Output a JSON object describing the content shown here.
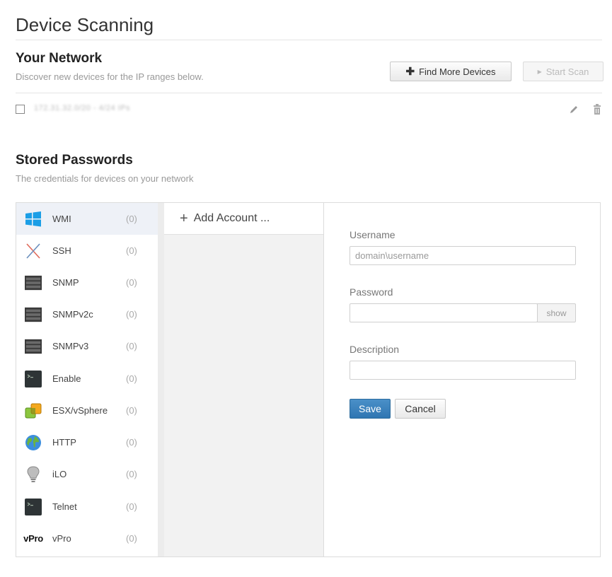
{
  "page": {
    "title": "Device Scanning"
  },
  "network": {
    "title": "Your Network",
    "subtitle": "Discover new devices for the IP ranges below.",
    "find_more_label": "Find More Devices",
    "start_scan_label": "Start Scan",
    "ip_range": "172.31.32.0/20 - 4/24 IPs"
  },
  "passwords": {
    "title": "Stored Passwords",
    "subtitle": "The credentials for devices on your network",
    "types": [
      {
        "label": "WMI",
        "count": "(0)",
        "icon": "windows-icon"
      },
      {
        "label": "SSH",
        "count": "(0)",
        "icon": "ssh-icon"
      },
      {
        "label": "SNMP",
        "count": "(0)",
        "icon": "server-icon"
      },
      {
        "label": "SNMPv2c",
        "count": "(0)",
        "icon": "server-icon"
      },
      {
        "label": "SNMPv3",
        "count": "(0)",
        "icon": "server-icon"
      },
      {
        "label": "Enable",
        "count": "(0)",
        "icon": "terminal-icon"
      },
      {
        "label": "ESX/vSphere",
        "count": "(0)",
        "icon": "vsphere-icon"
      },
      {
        "label": "HTTP",
        "count": "(0)",
        "icon": "globe-icon"
      },
      {
        "label": "iLO",
        "count": "(0)",
        "icon": "lightbulb-icon"
      },
      {
        "label": "Telnet",
        "count": "(0)",
        "icon": "terminal-icon"
      },
      {
        "label": "vPro",
        "count": "(0)",
        "icon": "vpro-icon"
      }
    ],
    "vpro_logo": "vPro",
    "add_account_label": "Add Account ...",
    "form": {
      "username_label": "Username",
      "username_placeholder": "domain\\username",
      "password_label": "Password",
      "show_label": "show",
      "description_label": "Description",
      "save_label": "Save",
      "cancel_label": "Cancel"
    }
  },
  "colors": {
    "accent": "#3a82be",
    "selected_row": "#eef1f7"
  }
}
